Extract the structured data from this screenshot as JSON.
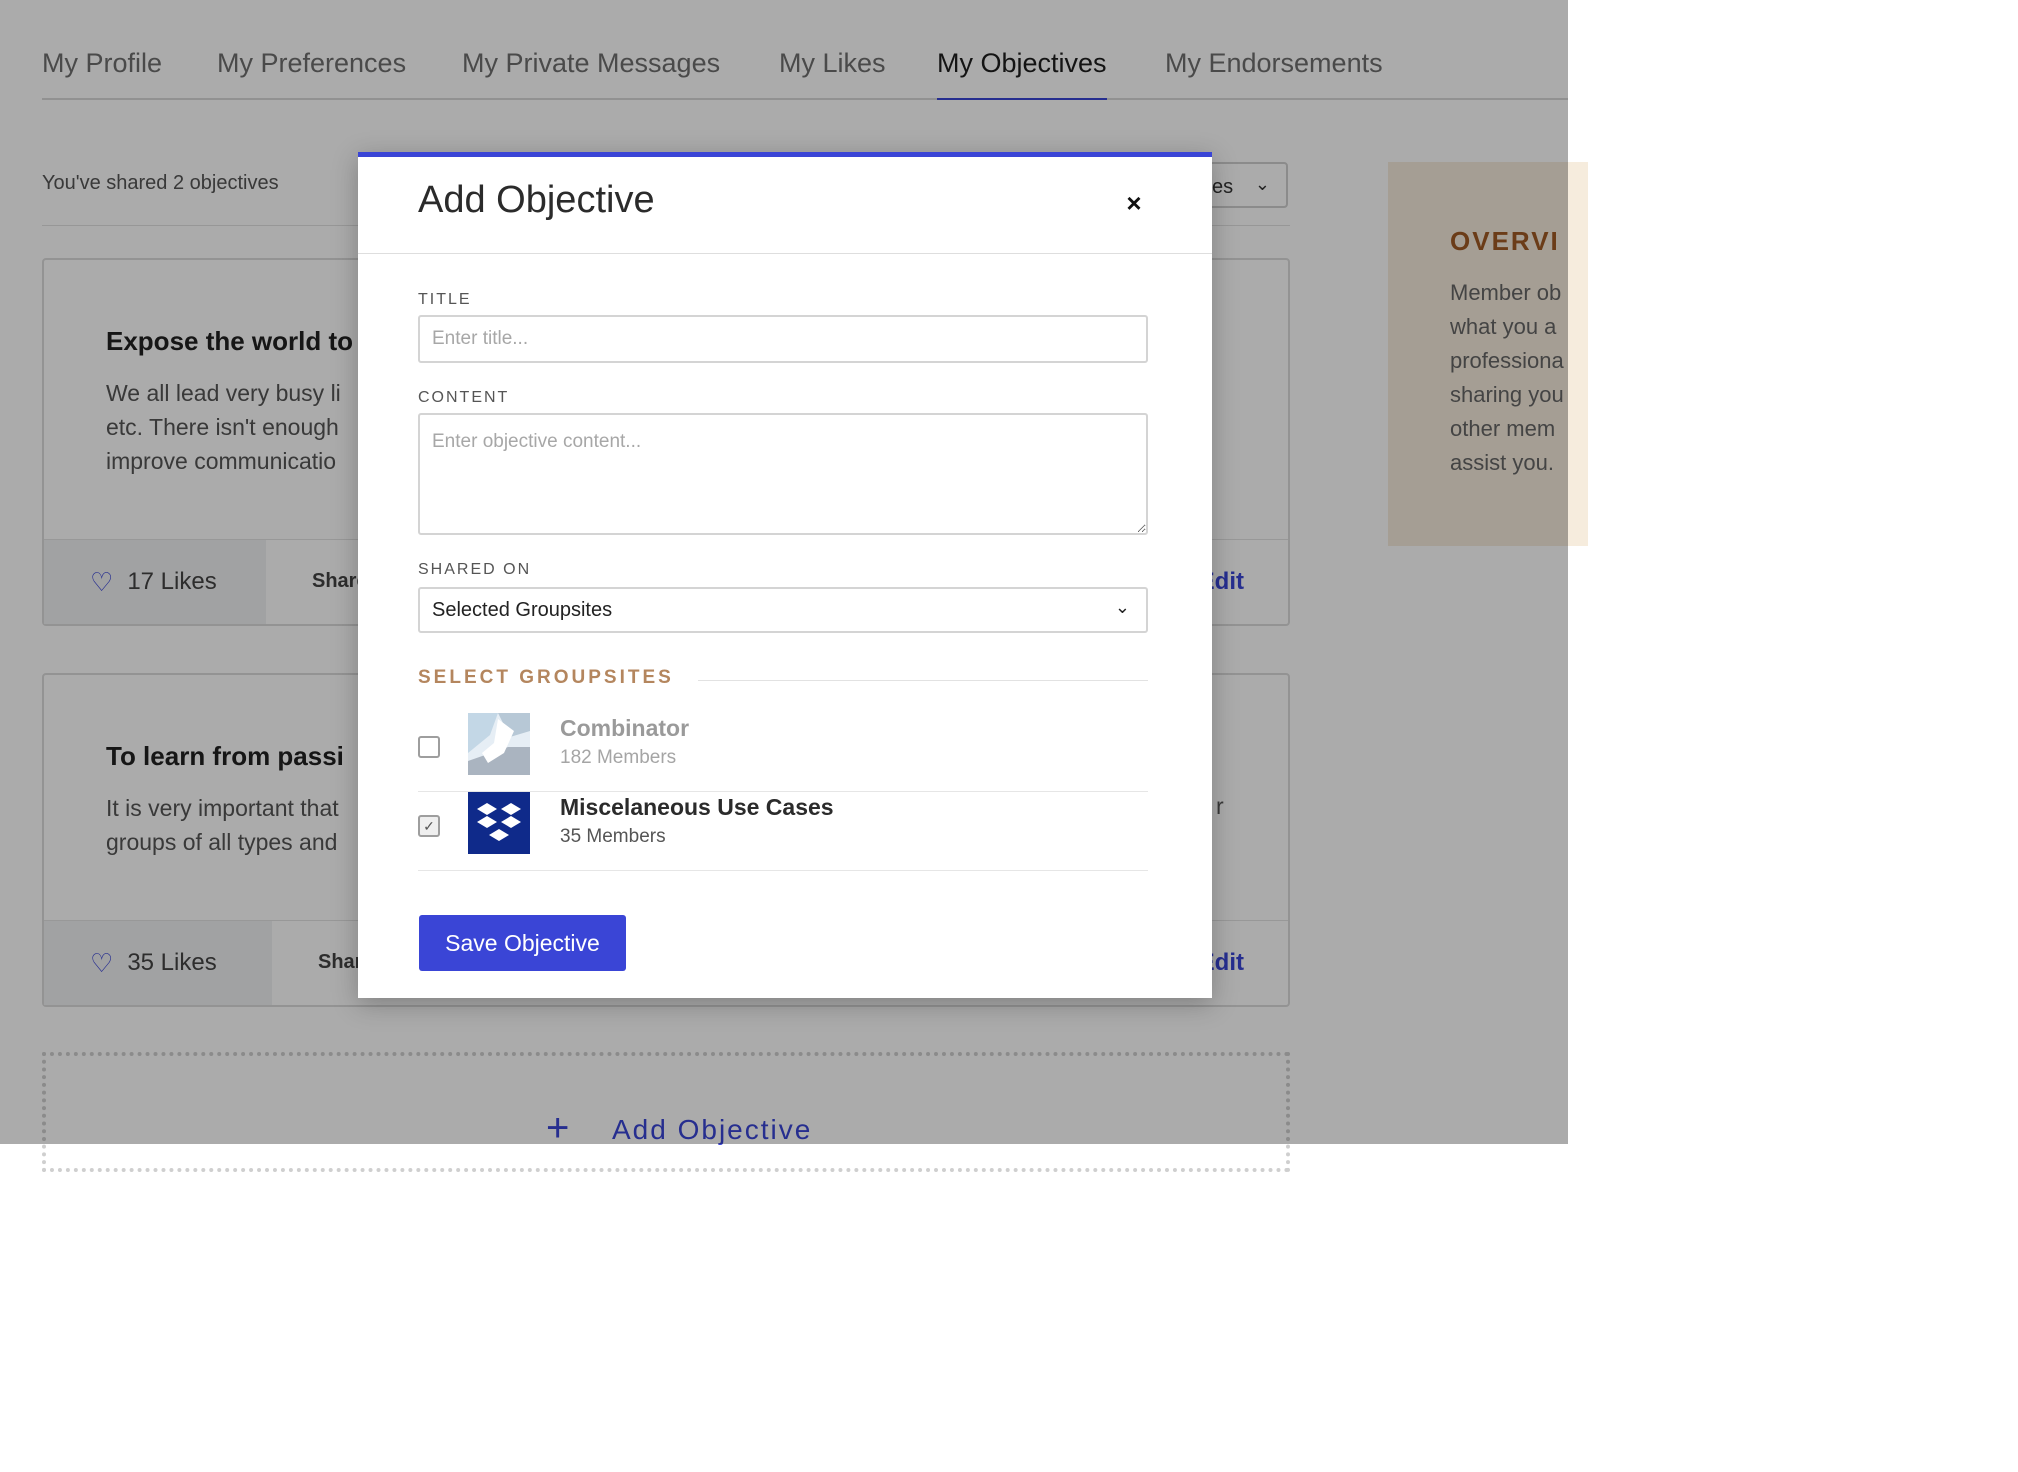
{
  "tabs": [
    "My Profile",
    "My Preferences",
    "My Private Messages",
    "My Likes",
    "My Objectives",
    "My Endorsements"
  ],
  "active_tab": "My Objectives",
  "summary": {
    "shared_count_text": "You've shared 2 objectives",
    "sort_label_partial": "es"
  },
  "cards": [
    {
      "title": "Expose the world to",
      "body": "We all lead very busy li… etc. There isn't enough … improve communicatio…",
      "body_lines": [
        "We all lead very busy li",
        "etc. There isn't enough",
        "improve communicatio"
      ],
      "likes": "17 Likes",
      "share": "Share",
      "edit": "Edit"
    },
    {
      "title": "To learn from passi",
      "body_lines": [
        "It is very important that",
        "groups of all types and"
      ],
      "likes": "35 Likes",
      "share": "Shar",
      "edit": "Edit",
      "trailing": "r"
    }
  ],
  "add_objective_link": "Add Objective",
  "sidebar": {
    "heading": "OVERVI",
    "lines": [
      "Member ob",
      "what you a",
      "professiona",
      "sharing you",
      "other mem",
      "assist you."
    ]
  },
  "modal": {
    "title": "Add Objective",
    "close_symbol": "×",
    "title_label": "TITLE",
    "title_placeholder": "Enter title...",
    "content_label": "CONTENT",
    "content_placeholder": "Enter objective content...",
    "shared_on_label": "SHARED ON",
    "shared_on_value": "Selected Groupsites",
    "section_title": "SELECT GROUPSITES",
    "groups": [
      {
        "name": "Combinator",
        "members": "182 Members",
        "checked": false,
        "icon": "combinator-logo"
      },
      {
        "name": "Miscelaneous Use Cases",
        "members": "35 Members",
        "checked": true,
        "icon": "dropbox-logo"
      }
    ],
    "save_label": "Save Objective"
  },
  "colors": {
    "accent": "#3a45d6",
    "section_title": "#b4865e",
    "overview_bg": "#f6ecdd",
    "overview_heading": "#a05a25"
  }
}
